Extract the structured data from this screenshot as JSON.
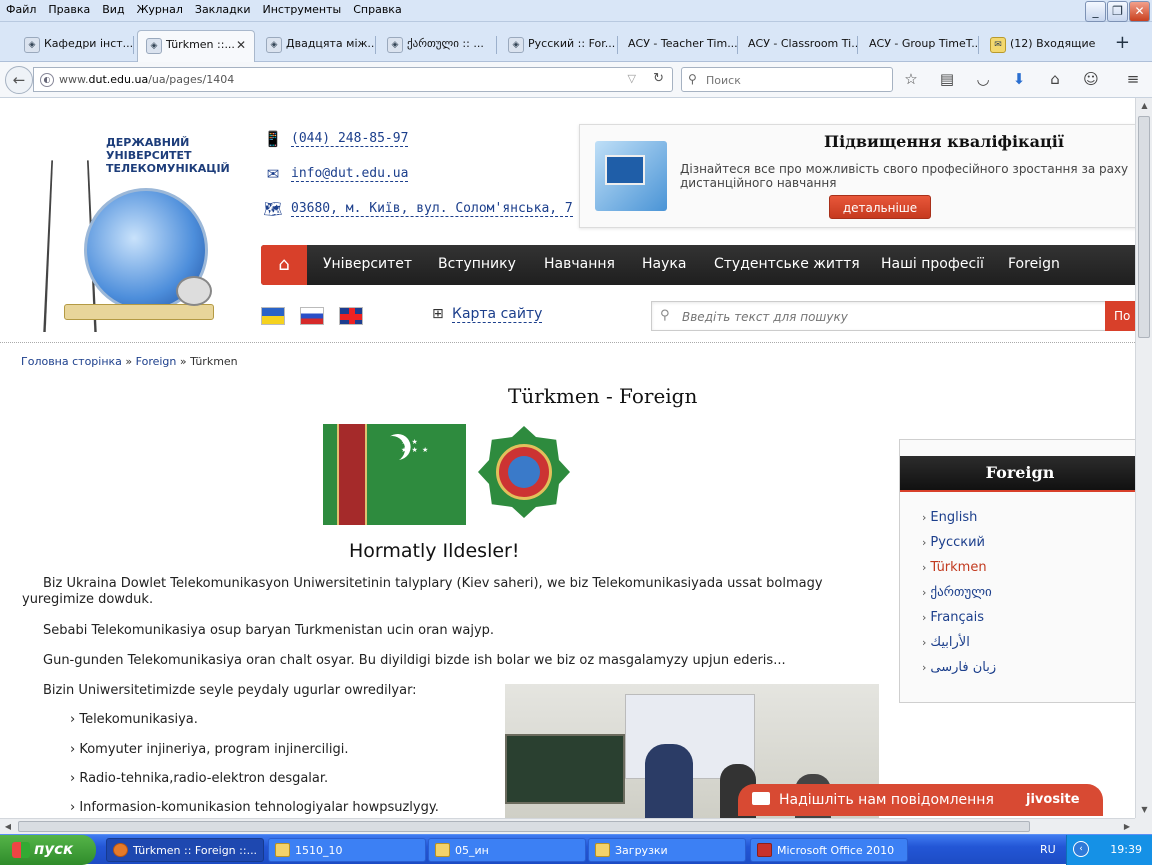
{
  "browser": {
    "menu": [
      "Файл",
      "Правка",
      "Вид",
      "Журнал",
      "Закладки",
      "Инструменты",
      "Справка"
    ],
    "tabs": [
      {
        "label": "Кафедри інст..."
      },
      {
        "label": "Türkmen ::..."
      },
      {
        "label": "Двадцята між..."
      },
      {
        "label": "ქართული :: ..."
      },
      {
        "label": "Русский :: For..."
      },
      {
        "label": "АСУ - Teacher Tim..."
      },
      {
        "label": "АСУ - Classroom Ti..."
      },
      {
        "label": "АСУ - Group TimeT..."
      },
      {
        "label": "(12) Входящие"
      }
    ],
    "url_prefix": "www.",
    "url_domain": "dut.edu.ua",
    "url_path": "/ua/pages/1404",
    "search_placeholder": "Поиск"
  },
  "site": {
    "logo_text": "ДЕРЖАВНИЙ УНІВЕРСИТЕТ ТЕЛЕКОМУНІКАЦІЙ",
    "phone": "(044) 248-85-97",
    "email": "info@dut.edu.ua",
    "address": "03680, м. Київ, вул. Солом'янська, 7",
    "promo": {
      "title": "Підвищення кваліфікації",
      "text": "Дізнайтеся все про можливість свого професійного зростання за раху\nдистанційного навчання",
      "button": "детальніше"
    },
    "nav": [
      "Університет",
      "Вступнику",
      "Навчання",
      "Наука",
      "Студентське життя",
      "Наші професії",
      "Foreign"
    ],
    "sitemap": "Карта сайту",
    "search_placeholder": "Введіть текст для пошуку",
    "search_button": "По"
  },
  "breadcrumb": {
    "home": "Головна сторінка",
    "sep": "»",
    "parent": "Foreign",
    "current": "Türkmen"
  },
  "page": {
    "title": "Türkmen - Foreign",
    "greeting": "Hormatly Ildesler!",
    "p1": "Biz Ukraina Dowlet Telekomunikasyon Uniwersitetinin talyplary (Kiev saheri), we biz Telekomunikasiyada ussat bolmagy yuregimize dowduk.",
    "p2": "Sebabi Telekomunikasiya osup baryan Turkmenistan ucin oran wajyp.",
    "p3": "Gun-gunden Telekomunikasiya oran chalt osyar. Bu diyildigi bizde ish bolar we biz oz masgalamyzy upjun ederis...",
    "p4": "Bizin Uniwersitetimizde seyle peydaly ugurlar owredilyar:",
    "list": [
      "Telekomunikasiya.",
      "Komyuter injineriya, program injinerciligi.",
      "Radio-tehnika,radio-elektron desgalar.",
      "Informasion-komunikasion tehnologiyalar howpsuzlygy."
    ]
  },
  "sidebar": {
    "title": "Foreign",
    "items": [
      {
        "label": "English"
      },
      {
        "label": "Русский"
      },
      {
        "label": "Türkmen"
      },
      {
        "label": "ქართული"
      },
      {
        "label": "Français"
      },
      {
        "label": "الأرابيك"
      },
      {
        "label": "زبان فارسی"
      }
    ]
  },
  "chat": {
    "label": "Надішліть нам повідомлення",
    "brand": "jivosite"
  },
  "taskbar": {
    "start": "пуск",
    "items": [
      {
        "label": "Türkmen :: Foreign ::..."
      },
      {
        "label": "1510_10"
      },
      {
        "label": "05_ин"
      },
      {
        "label": "Загрузки"
      },
      {
        "label": "Microsoft Office 2010"
      }
    ],
    "lang": "RU",
    "time": "19:39"
  },
  "colors": {
    "accent": "#d8402a",
    "link": "#1c3f8c",
    "taskbar": "#2356d6"
  }
}
